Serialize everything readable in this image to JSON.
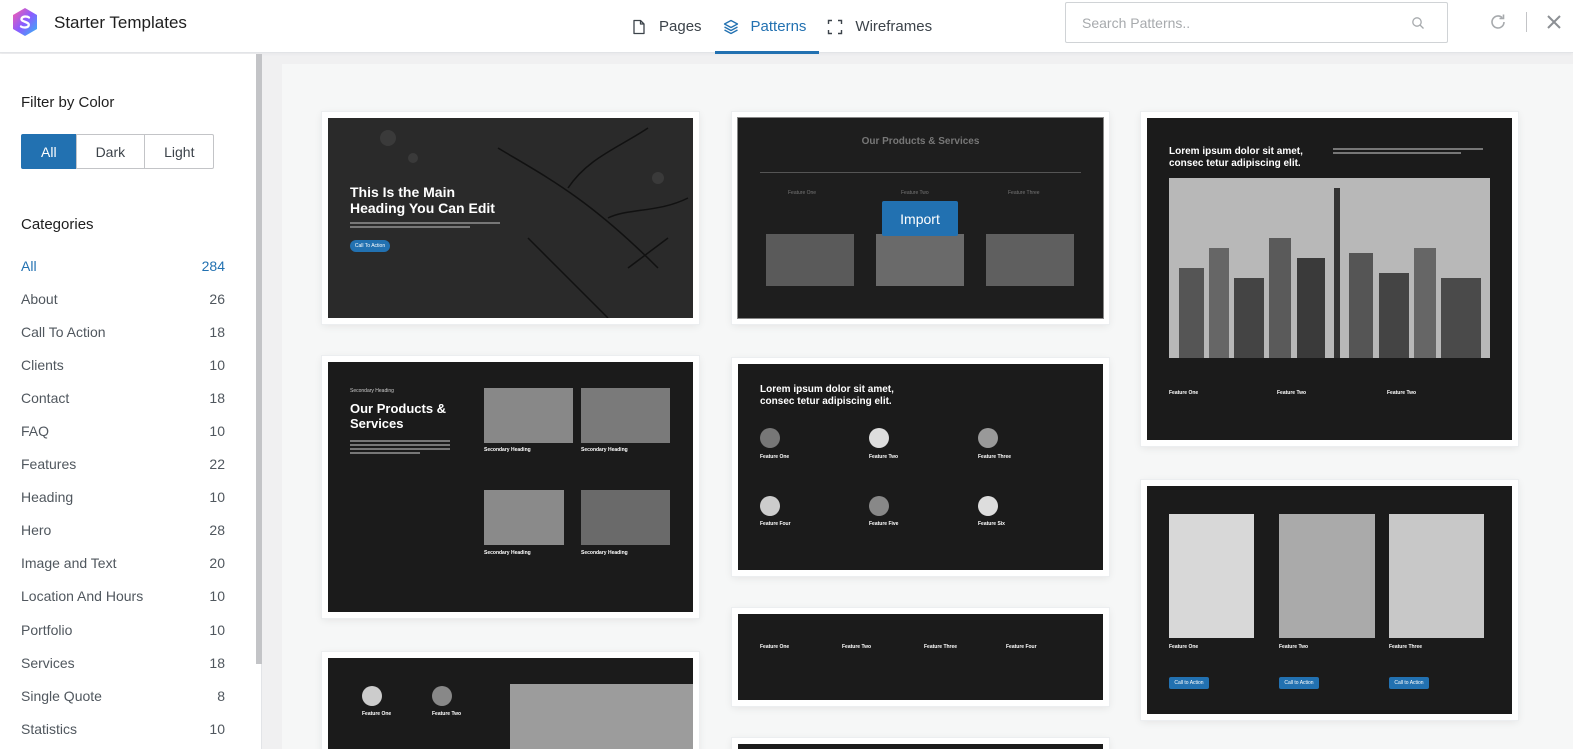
{
  "app": {
    "title": "Starter Templates"
  },
  "tabs": [
    {
      "label": "Pages",
      "icon": "document-icon",
      "active": false
    },
    {
      "label": "Patterns",
      "icon": "layers-icon",
      "active": true
    },
    {
      "label": "Wireframes",
      "icon": "frame-corners-icon",
      "active": false
    }
  ],
  "search": {
    "placeholder": "Search Patterns..",
    "value": ""
  },
  "filter": {
    "title": "Filter by Color",
    "options": [
      "All",
      "Dark",
      "Light"
    ],
    "selected": "All"
  },
  "categories": {
    "title": "Categories",
    "items": [
      {
        "label": "All",
        "count": "284",
        "active": true
      },
      {
        "label": "About",
        "count": "26"
      },
      {
        "label": "Call To Action",
        "count": "18"
      },
      {
        "label": "Clients",
        "count": "10"
      },
      {
        "label": "Contact",
        "count": "18"
      },
      {
        "label": "FAQ",
        "count": "10"
      },
      {
        "label": "Features",
        "count": "22"
      },
      {
        "label": "Heading",
        "count": "10"
      },
      {
        "label": "Hero",
        "count": "28"
      },
      {
        "label": "Image and Text",
        "count": "20"
      },
      {
        "label": "Location And Hours",
        "count": "10"
      },
      {
        "label": "Portfolio",
        "count": "10"
      },
      {
        "label": "Services",
        "count": "18"
      },
      {
        "label": "Single Quote",
        "count": "8"
      },
      {
        "label": "Statistics",
        "count": "10"
      }
    ]
  },
  "colors": {
    "accent": "#2271b1",
    "thumb_bg": "#1b1b1b"
  },
  "patterns": {
    "import_label": "Import",
    "hero": {
      "heading": "This Is the Main Heading You Can Edit",
      "button": "Call To Action"
    },
    "products": {
      "title": "Our Products & Services",
      "features": [
        "Feature One",
        "Feature Two",
        "Feature Three"
      ]
    },
    "city": {
      "heading": "Lorem ipsum dolor sit amet, consec tetur adipiscing elit.",
      "features": [
        "Feature One",
        "Feature Two",
        "Feature Two"
      ]
    },
    "services": {
      "eyebrow": "Secondary Heading",
      "title": "Our Products & Services",
      "items": [
        "Secondary Heading",
        "Secondary Heading",
        "Secondary Heading",
        "Secondary Heading"
      ]
    },
    "features6": {
      "heading": "Lorem ipsum dolor sit amet, consec tetur adipiscing elit.",
      "items": [
        "Feature One",
        "Feature Two",
        "Feature Three",
        "Feature Four",
        "Feature Five",
        "Feature Six"
      ]
    },
    "features4": {
      "items": [
        "Feature One",
        "Feature Two",
        "Feature Three",
        "Feature Four"
      ]
    },
    "plants": {
      "items": [
        "Feature One",
        "Feature Two",
        "Feature Three"
      ],
      "button": "Call to Action"
    },
    "bottom": {
      "items": [
        "Feature One",
        "Feature Two"
      ]
    }
  }
}
